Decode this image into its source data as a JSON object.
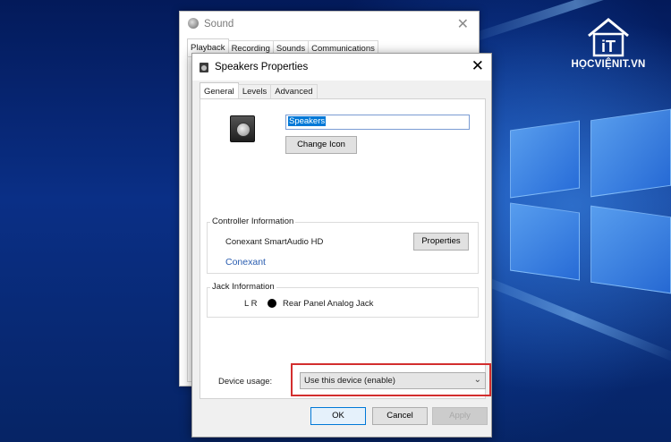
{
  "brand": {
    "logo_text": "iT",
    "caption": "HỌCVIỆNIT.VN"
  },
  "sound_window": {
    "title": "Sound",
    "close_glyph": "✕",
    "tabs": [
      "Playback",
      "Recording",
      "Sounds",
      "Communications"
    ],
    "active_tab": "Playback"
  },
  "properties_dialog": {
    "title": "Speakers Properties",
    "close_glyph": "✕",
    "tabs": [
      "General",
      "Levels",
      "Advanced"
    ],
    "active_tab": "General",
    "device_name_value": "Speakers",
    "change_icon_label": "Change Icon",
    "controller": {
      "group_label": "Controller Information",
      "name": "Conexant SmartAudio HD",
      "properties_label": "Properties",
      "vendor_link": "Conexant"
    },
    "jack": {
      "group_label": "Jack Information",
      "channels": "L R",
      "description": "Rear Panel Analog Jack"
    },
    "device_usage": {
      "label": "Device usage:",
      "selected": "Use this device (enable)"
    },
    "buttons": {
      "ok": "OK",
      "cancel": "Cancel",
      "apply": "Apply"
    }
  },
  "colors": {
    "highlight_border": "#d32e2e",
    "link": "#2a5db0",
    "selection": "#0078d7",
    "desktop": "#0a2f86"
  }
}
